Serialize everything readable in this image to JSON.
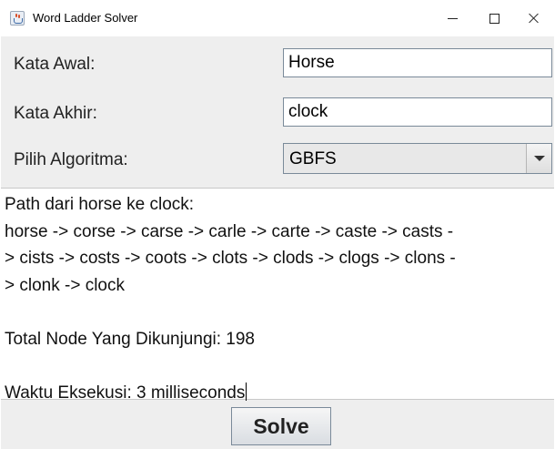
{
  "window": {
    "title": "Word Ladder Solver",
    "icon": "java-cup-icon",
    "controls": {
      "minimize": "minimize-icon",
      "maximize": "maximize-icon",
      "close": "close-icon"
    }
  },
  "form": {
    "start_label": "Kata Awal:",
    "start_value": "Horse",
    "end_label": "Kata Akhir:",
    "end_value": "clock",
    "algo_label": "Pilih Algoritma:",
    "algo_selected": "GBFS"
  },
  "output": {
    "path_header": "Path dari horse ke clock:",
    "path_lines": [
      "horse -> corse -> carse -> carle -> carte -> caste -> casts -",
      "> cists -> costs -> coots -> clots -> clods -> clogs -> clons -",
      "> clonk -> clock"
    ],
    "nodes_visited": "Total Node Yang Dikunjungi: 198",
    "exec_time": "Waktu Eksekusi: 3 milliseconds"
  },
  "actions": {
    "solve_label": "Solve"
  },
  "colors": {
    "panel": "#eeeeee",
    "field_border": "#7a8a99",
    "text": "#222222"
  }
}
